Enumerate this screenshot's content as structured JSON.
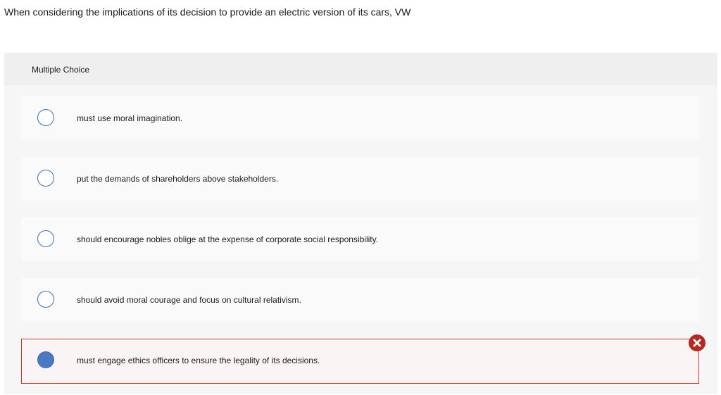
{
  "question": {
    "text": "When considering the implications of its decision to provide an electric version of its cars, VW"
  },
  "panel": {
    "title": "Multiple Choice"
  },
  "options": [
    {
      "label": "must use moral imagination.",
      "selected": false
    },
    {
      "label": "put the demands of shareholders above stakeholders.",
      "selected": false
    },
    {
      "label": "should encourage nobles oblige at the expense of corporate social responsibility.",
      "selected": false
    },
    {
      "label": "should avoid moral courage and focus on cultural relativism.",
      "selected": false
    },
    {
      "label": "must engage ethics officers to ensure the legality of its decisions.",
      "selected": true,
      "result": "incorrect"
    }
  ],
  "colors": {
    "radio_border": "#3d6fb5",
    "radio_selected_fill": "#4a78c2",
    "incorrect_border": "#c0392b",
    "incorrect_badge": "#b52a20"
  },
  "icons": {
    "incorrect": "x-circle-icon"
  }
}
